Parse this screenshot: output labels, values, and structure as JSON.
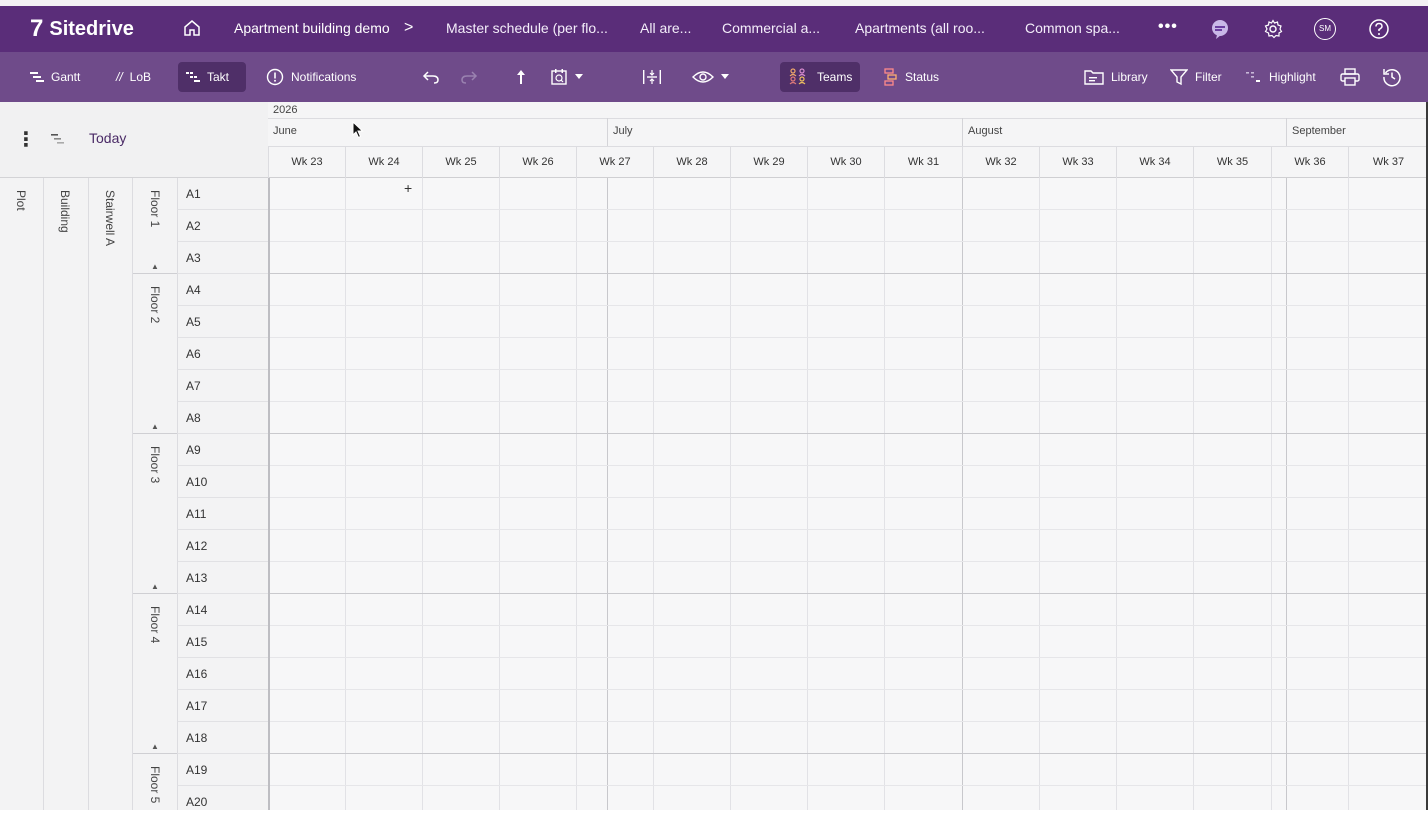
{
  "app": {
    "name": "Sitedrive",
    "logo_mark": "7"
  },
  "nav": {
    "breadcrumbs": [
      "Apartment building demo",
      "Master schedule (per flo...",
      "All are...",
      "Commercial a...",
      "Apartments (all roo...",
      "Common spa..."
    ],
    "crumb_separator": ">",
    "more": "•••",
    "avatar_initials": "SM"
  },
  "toolbar": {
    "gantt": "Gantt",
    "lob": "LoB",
    "lob_icon": "//",
    "takt": "Takt",
    "notifications": "Notifications",
    "teams": "Teams",
    "status": "Status",
    "library": "Library",
    "filter": "Filter",
    "highlight": "Highlight"
  },
  "left_header": {
    "kebab": "⋮",
    "today": "Today"
  },
  "timeline": {
    "year": "2026",
    "months": [
      "June",
      "July",
      "August",
      "September"
    ],
    "weeks": [
      "Wk 23",
      "Wk 24",
      "Wk 25",
      "Wk 26",
      "Wk 27",
      "Wk 28",
      "Wk 29",
      "Wk 30",
      "Wk 31",
      "Wk 32",
      "Wk 33",
      "Wk 34",
      "Wk 35",
      "Wk 36",
      "Wk 37"
    ]
  },
  "hierarchy": {
    "plot": "Plot",
    "building": "Building",
    "stairwell": "Stairwell A",
    "floors": [
      {
        "label": "Floor 1",
        "areas": [
          "A1",
          "A2",
          "A3"
        ]
      },
      {
        "label": "Floor 2",
        "areas": [
          "A4",
          "A5",
          "A6",
          "A7",
          "A8"
        ]
      },
      {
        "label": "Floor 3",
        "areas": [
          "A9",
          "A10",
          "A11",
          "A12",
          "A13"
        ]
      },
      {
        "label": "Floor 4",
        "areas": [
          "A14",
          "A15",
          "A16",
          "A17",
          "A18"
        ]
      },
      {
        "label": "Floor 5",
        "areas": [
          "A19",
          "A20"
        ]
      }
    ]
  },
  "colors": {
    "nav_bg": "#5a2d79",
    "toolbar_bg": "#6f4b8a",
    "active_bg": "#4f2f68"
  }
}
